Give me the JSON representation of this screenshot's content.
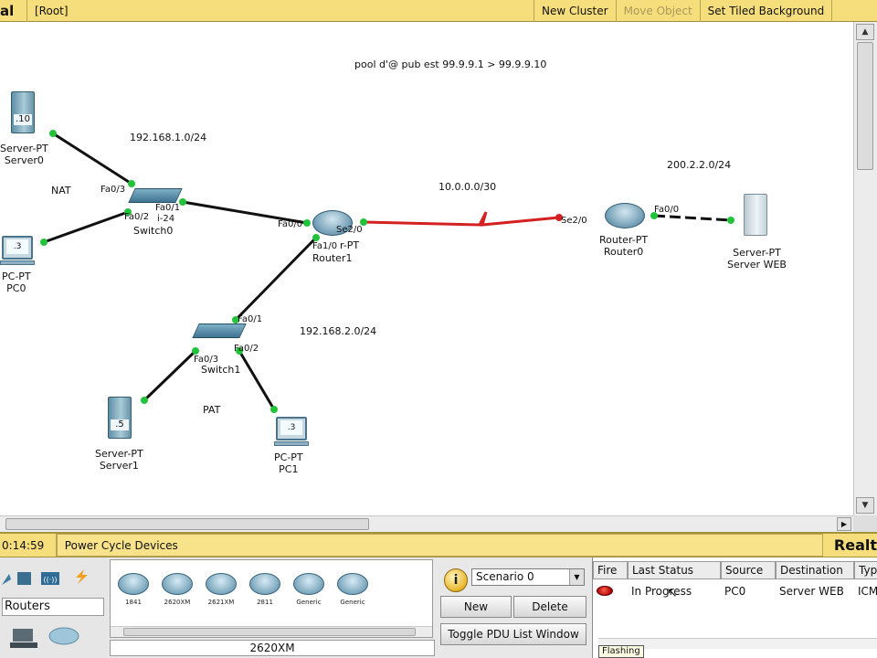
{
  "toolbar": {
    "title": "al",
    "root": "[Root]",
    "new_cluster": "New Cluster",
    "move_object": "Move Object",
    "set_background": "Set Tiled Background"
  },
  "canvas": {
    "note": "pool d'@ pub est 99.9.9.1 > 99.9.9.10",
    "networks": {
      "lan1": "192.168.1.0/24",
      "lan2": "192.168.2.0/24",
      "wan": "10.0.0.0/30",
      "web": "200.2.2.0/24"
    },
    "tags": {
      "nat": "NAT",
      "pat": "PAT"
    },
    "devices": {
      "server0": {
        "type": "Server-PT",
        "name": "Server0",
        "badge": ".10"
      },
      "pc0": {
        "type": "PC-PT",
        "name": "PC0",
        "badge": ".3"
      },
      "switch0": {
        "name": "Switch0",
        "model_fragment": "i-24"
      },
      "router1": {
        "type": "r-PT",
        "name": "Router1"
      },
      "router0": {
        "type": "Router-PT",
        "name": "Router0"
      },
      "server_web": {
        "type": "Server-PT",
        "name": "Server WEB"
      },
      "switch1": {
        "name": "Switch1"
      },
      "server1": {
        "type": "Server-PT",
        "name": "Server1",
        "badge": ".5"
      },
      "pc1": {
        "type": "PC-PT",
        "name": "PC1",
        "badge": ".3"
      }
    },
    "ports": {
      "sw0_fa03": "Fa0/3",
      "sw0_fa02": "Fa0/2",
      "sw0_fa01": "Fa0/1",
      "r1_fa00": "Fa0/0",
      "r1_se20": "Se2/0",
      "r1_fa10": "Fa1/0",
      "sw1_fa01": "Fa0/1",
      "sw1_fa03": "Fa0/3",
      "sw1_fa02": "Fa0/2",
      "r0_se20": "Se2/0",
      "r0_fa00": "Fa0/0"
    }
  },
  "status": {
    "time": "0:14:59",
    "power_cycle": "Power Cycle Devices",
    "mode": "Realt"
  },
  "device_panel": {
    "category_label": "Routers",
    "models": [
      "1841",
      "2620XM",
      "2621XM",
      "2811",
      "Generic",
      "Generic"
    ],
    "selected_model": "2620XM"
  },
  "scenario": {
    "info": "i",
    "selected": "Scenario 0",
    "new_label": "New",
    "delete_label": "Delete",
    "toggle_label": "Toggle PDU List Window"
  },
  "pdu_table": {
    "headers": [
      "Fire",
      "Last Status",
      "Source",
      "Destination",
      "Type"
    ],
    "rows": [
      {
        "last_status": "In Progress",
        "source": "PC0",
        "destination": "Server WEB",
        "type": "ICMP"
      }
    ],
    "tooltip": "Flashing"
  },
  "colors": {
    "toolbar": "#f6de7c",
    "link": "#111111",
    "serial_link": "#d42020",
    "port_up": "#22c33a"
  }
}
